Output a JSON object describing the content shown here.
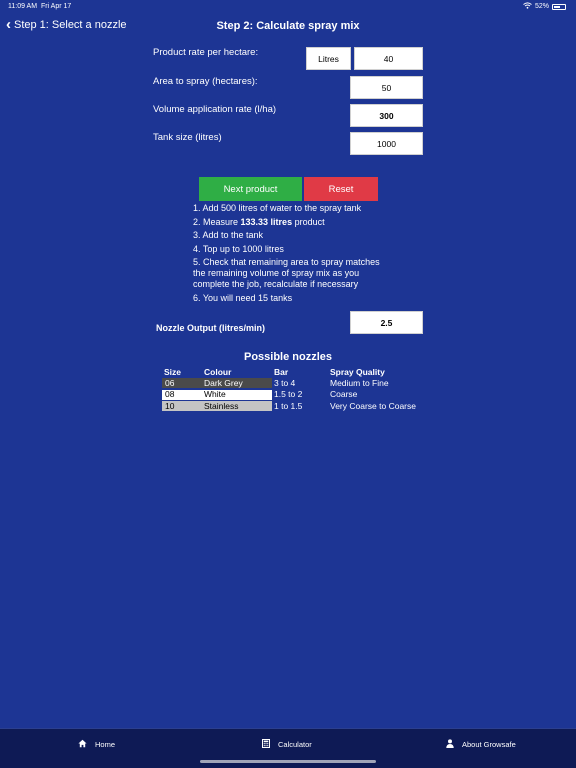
{
  "status_bar": {
    "time": "11:09 AM",
    "date": "Fri Apr 17",
    "battery": "52%"
  },
  "nav": {
    "back_label": "Step 1: Select a nozzle",
    "title": "Step 2: Calculate spray mix"
  },
  "form": {
    "product_rate_label": "Product rate per hectare:",
    "unit_value": "Litres",
    "product_rate_value": "40",
    "area_label": "Area to spray (hectares):",
    "area_value": "50",
    "volume_label": "Volume application rate (l/ha)",
    "volume_value": "300",
    "tank_label": "Tank size (litres)",
    "tank_value": "1000"
  },
  "buttons": {
    "next": "Next product",
    "reset": "Reset"
  },
  "instructions": {
    "step1": "1. Add 500 litres of water to the spray tank",
    "step2_prefix": "2. Measure ",
    "step2_bold": "133.33 litres",
    "step2_suffix": " product",
    "step3": "3. Add to the tank",
    "step4": "4. Top up to 1000 litres",
    "step5": "5. Check that remaining area to spray matches the remaining volume of spray mix as you complete the job, recalculate if necessary",
    "step6": "6. You will need 15 tanks"
  },
  "nozzle_output": {
    "label": "Nozzle Output (litres/min)",
    "value": "2.5"
  },
  "nozzles": {
    "title": "Possible nozzles",
    "headers": {
      "size": "Size",
      "colour": "Colour",
      "bar": "Bar",
      "quality": "Spray Quality"
    },
    "rows": [
      {
        "size": "06",
        "colour": "Dark Grey",
        "bar": "3 to 4",
        "quality": "Medium to Fine",
        "swatch": "#4a4a4a",
        "text": "#ffffff"
      },
      {
        "size": "08",
        "colour": "White",
        "bar": "1.5 to 2",
        "quality": "Coarse",
        "swatch": "#ffffff",
        "text": "#000000"
      },
      {
        "size": "10",
        "colour": "Stainless",
        "bar": "1 to 1.5",
        "quality": "Very Coarse to Coarse",
        "swatch": "#c4c4c4",
        "text": "#000000"
      }
    ]
  },
  "tabbar": {
    "home": "Home",
    "calculator": "Calculator",
    "about": "About Growsafe"
  },
  "colors": {
    "background": "#1d3594",
    "next": "#2fae45",
    "reset": "#e03a46",
    "tabbar": "#0e1a55"
  }
}
